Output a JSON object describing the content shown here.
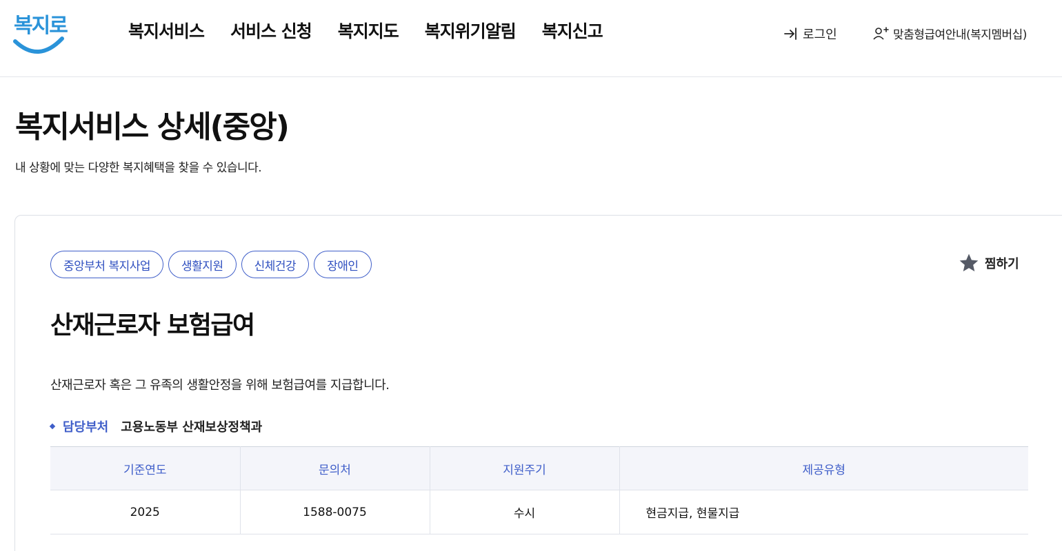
{
  "header": {
    "logo_text": "복지로",
    "nav": [
      "복지서비스",
      "서비스 신청",
      "복지지도",
      "복지위기알림",
      "복지신고"
    ],
    "login_label": "로그인",
    "member_label": "맞춤형급여안내(복지멤버십)"
  },
  "page": {
    "title": "복지서비스 상세(중앙)",
    "description": "내 상황에 맞는 다양한 복지혜택을 찾을 수 있습니다."
  },
  "service": {
    "tags": [
      "중앙부처 복지사업",
      "생활지원",
      "신체건강",
      "장애인"
    ],
    "favorite_label": "찜하기",
    "name": "산재근로자 보험급여",
    "summary": "산재근로자 혹은 그 유족의 생활안정을 위해 보험급여를 지급합니다.",
    "department_label": "담당부처",
    "department_value": "고용노동부 산재보상정책과",
    "table": {
      "headers": [
        "기준연도",
        "문의처",
        "지원주기",
        "제공유형"
      ],
      "row": [
        "2025",
        "1588-0075",
        "수시",
        "현금지급, 현물지급"
      ]
    }
  },
  "colors": {
    "accent": "#3f5ec9",
    "logo": "#2a93d9",
    "table_header_bg": "#f4f5fa",
    "star": "#555a66"
  },
  "icons": {
    "login": "login-arrow-icon",
    "member": "person-add-icon",
    "favorite": "star-icon"
  }
}
